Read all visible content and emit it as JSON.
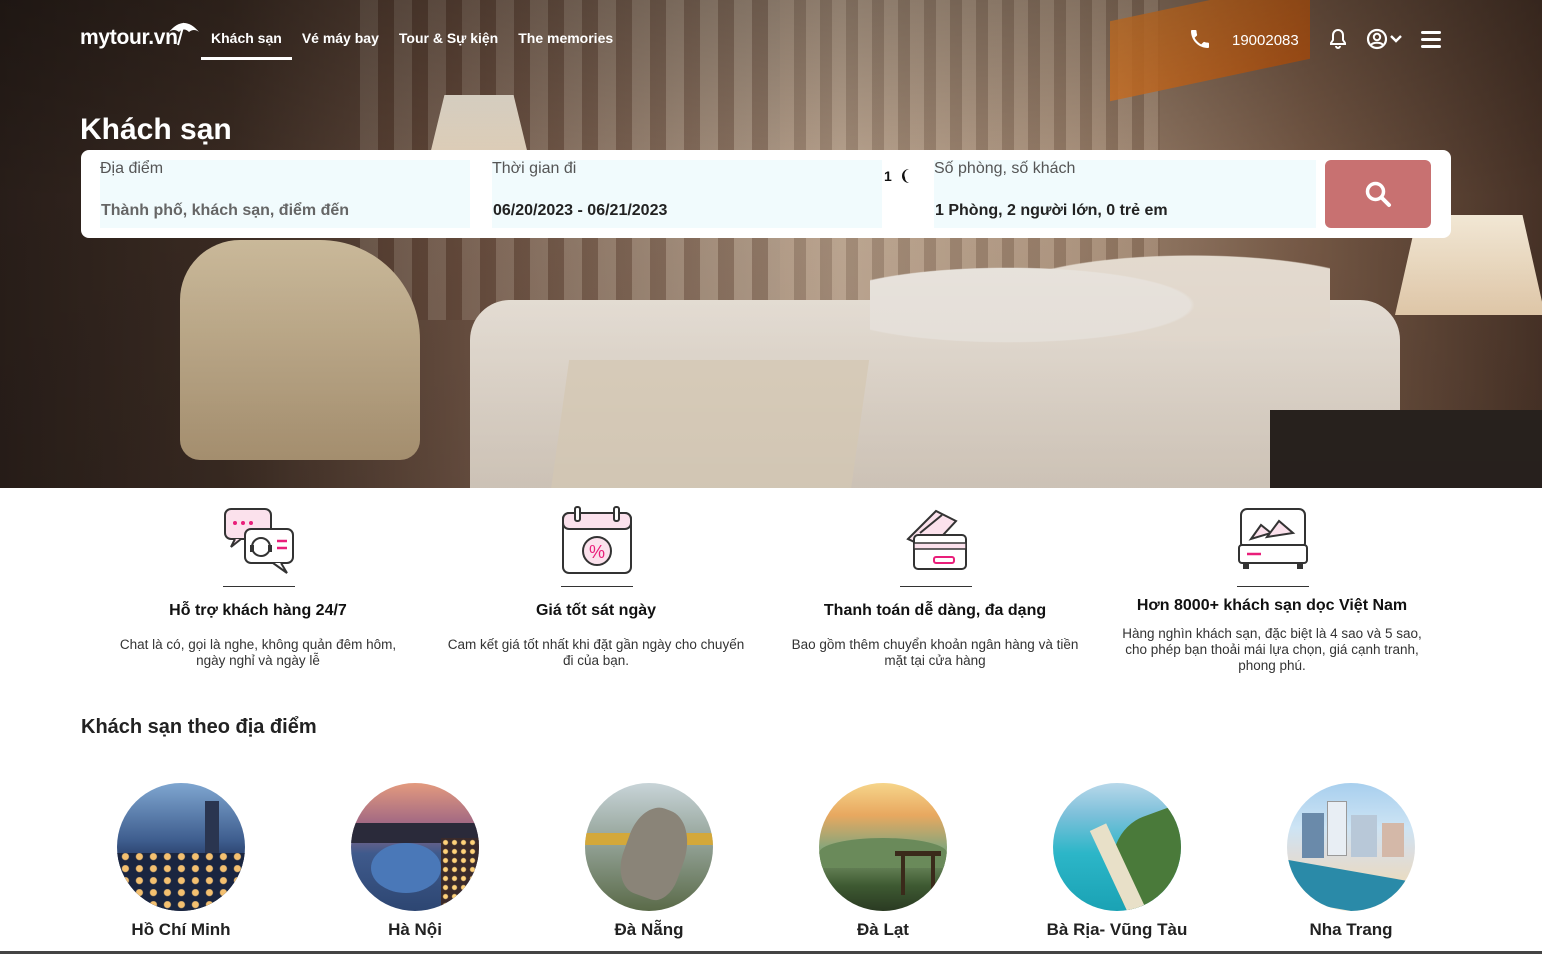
{
  "header": {
    "logo": "mytour.vn",
    "nav": [
      "Khách sạn",
      "Vé máy bay",
      "Tour & Sự kiện",
      "The memories"
    ],
    "phone": "19002083"
  },
  "hero": {
    "title": "Khách sạn"
  },
  "search": {
    "location_label": "Địa điểm",
    "location_placeholder": "Thành phố, khách sạn, điểm đến",
    "date_label": "Thời gian đi",
    "date_value": "06/20/2023 - 06/21/2023",
    "nights": "1",
    "room_label": "Số phòng, số khách",
    "room_value": "1 Phòng, 2 người lớn, 0 trẻ em"
  },
  "features": [
    {
      "icon": "support-chat-icon",
      "title": "Hỗ trợ khách hàng 24/7",
      "desc": "Chat là có, gọi là nghe, không quản đêm hôm, ngày nghỉ và ngày lễ"
    },
    {
      "icon": "calendar-discount-icon",
      "title": "Giá tốt sát ngày",
      "desc": "Cam kết giá tốt nhất khi đặt gần ngày cho chuyến đi của bạn."
    },
    {
      "icon": "credit-card-icon",
      "title": "Thanh toán dễ dàng, đa dạng",
      "desc": "Bao gồm thêm chuyển khoản ngân hàng và tiền mặt tại cửa hàng"
    },
    {
      "icon": "hotel-bed-icon",
      "title": "Hơn 8000+ khách sạn dọc Việt Nam",
      "desc": "Hàng nghìn khách sạn, đặc biệt là 4 sao và 5 sao, cho phép bạn thoải mái lựa chọn, giá cạnh tranh, phong phú."
    }
  ],
  "locations_section": {
    "title": "Khách sạn theo địa điểm",
    "items": [
      "Hồ Chí Minh",
      "Hà Nội",
      "Đà Nẵng",
      "Đà Lạt",
      "Bà Rịa- Vũng Tàu",
      "Nha Trang"
    ]
  },
  "colors": {
    "accent": "#c87171",
    "field_bg": "#f1fbfd",
    "icon_pink": "#e91e7a"
  }
}
